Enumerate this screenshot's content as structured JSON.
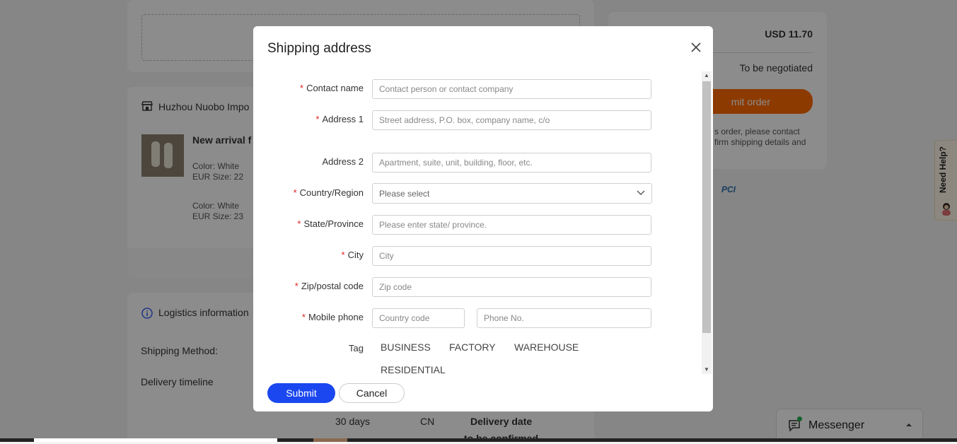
{
  "background": {
    "store_name": "Huzhou Nuobo Impo",
    "product_title": "New arrival f",
    "variant1_color": "Color: White",
    "variant1_size": "EUR Size: 22",
    "variant2_color": "Color: White",
    "variant2_size": "EUR Size: 23",
    "logistics_title": "Logistics information",
    "shipping_method_label": "Shipping Method:",
    "delivery_timeline_label": "Delivery timeline",
    "days": "30 days",
    "origin": "CN",
    "delivery_date_label": "Delivery date",
    "delivery_date_value": "to be confirmed",
    "price": "USD 11.70",
    "shipping_cost": "To be negotiated",
    "submit_order_label": "mit order",
    "note_line1": "s order, please contact",
    "note_line2": "firm shipping details and",
    "pci_text": "PCI",
    "need_help_label": "Need Help?",
    "messenger_label": "Messenger"
  },
  "modal": {
    "title": "Shipping address",
    "fields": {
      "contact_name": {
        "label": "Contact name",
        "placeholder": "Contact person or contact company"
      },
      "address1": {
        "label": "Address 1",
        "placeholder": "Street address, P.O. box, company name, c/o"
      },
      "address2": {
        "label": "Address 2",
        "placeholder": "Apartment, suite, unit, building, floor, etc."
      },
      "country": {
        "label": "Country/Region",
        "placeholder": "Please select"
      },
      "state": {
        "label": "State/Province",
        "placeholder": "Please enter state/ province."
      },
      "city": {
        "label": "City",
        "placeholder": "City"
      },
      "zip": {
        "label": "Zip/postal code",
        "placeholder": "Zip code"
      },
      "mobile": {
        "label": "Mobile phone",
        "country_code_placeholder": "Country code",
        "phone_placeholder": "Phone No."
      }
    },
    "tag_label": "Tag",
    "tags": [
      "BUSINESS",
      "FACTORY",
      "WAREHOUSE",
      "RESIDENTIAL"
    ],
    "submit_label": "Submit",
    "cancel_label": "Cancel",
    "required_mark": "*"
  },
  "colors": {
    "accent": "#1a47f0",
    "orange": "#ff6a00",
    "required": "#e02020"
  }
}
